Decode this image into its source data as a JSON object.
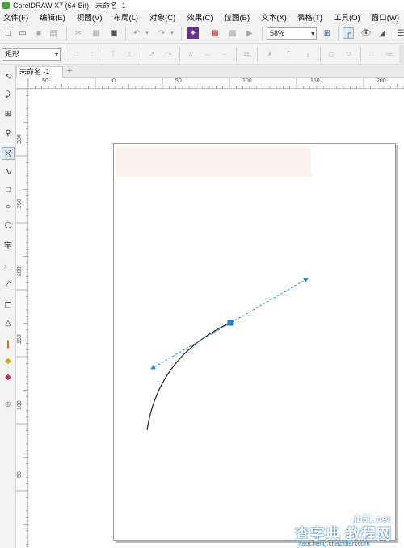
{
  "window": {
    "title": "CorelDRAW X7 (64-Bit) - 未命名 -1"
  },
  "menu": {
    "items": [
      "文件(F)",
      "编辑(E)",
      "视图(V)",
      "布局(L)",
      "对象(C)",
      "效果(C)",
      "位图(B)",
      "文本(X)",
      "表格(T)",
      "工具(O)",
      "窗口(W)"
    ]
  },
  "toolbar": {
    "zoom": "58%",
    "icons": [
      "new-icon",
      "open-icon",
      "save-icon",
      "print-icon",
      "cut-icon",
      "copy-icon",
      "paste-icon",
      "undo-icon",
      "redo-icon",
      "search-content-icon",
      "import-icon",
      "export-icon",
      "publish-pdf-icon",
      "zoom-icon",
      "full-screen-icon",
      "show-rulers-icon",
      "snap-icon",
      "options-icon"
    ]
  },
  "property_bar": {
    "shape_type": "矩形"
  },
  "document": {
    "tab_label": "未命名 -1",
    "add_tab": "+"
  },
  "rulers": {
    "horizontal": [
      "50",
      "0",
      "50",
      "100",
      "150",
      "200"
    ],
    "vertical": [
      "300",
      "250",
      "200",
      "150",
      "100",
      "50"
    ]
  },
  "watermark": {
    "line1": "jb51.net",
    "line2": "查字典 教程网",
    "line3": "jiaocheng.chazidian.com"
  },
  "colors": {
    "accent": "#1e88d6",
    "curve": "#222222",
    "page_shadow": "#bdbdbd"
  }
}
